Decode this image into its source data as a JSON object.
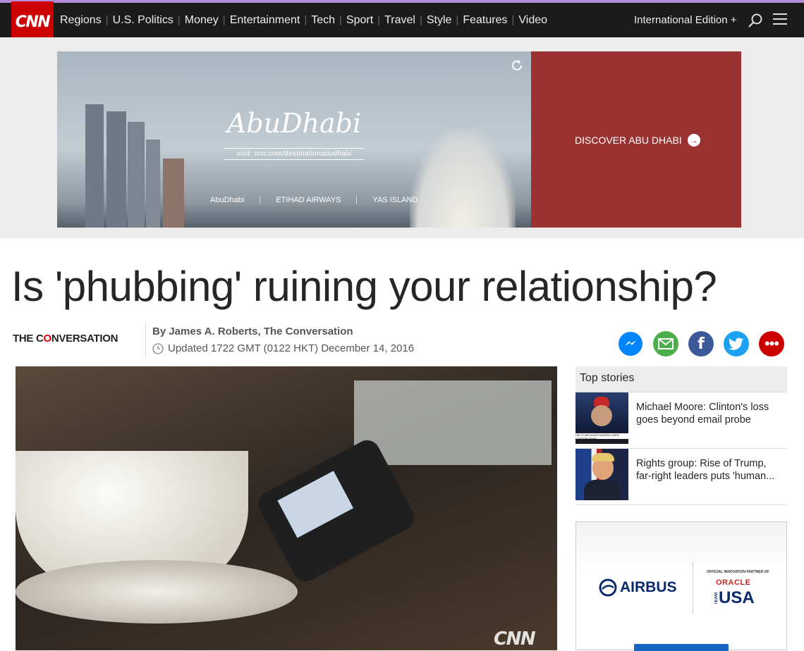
{
  "nav": {
    "logo": "CNN",
    "links": [
      "Regions",
      "U.S. Politics",
      "Money",
      "Entertainment",
      "Tech",
      "Sport",
      "Travel",
      "Style",
      "Features",
      "Video"
    ],
    "edition": "International Edition +"
  },
  "ad_banner": {
    "title": "AbuDhabi",
    "visit": "visit: cnn.com/destinationabudhabi",
    "logos": [
      "AbuDhabi",
      "ETIHAD AIRWAYS",
      "YAS ISLAND"
    ],
    "cta": "DISCOVER ABU DHABI",
    "cta_color": "#9b3232"
  },
  "article": {
    "headline": "Is 'phubbing' ruining your relationship?",
    "source_logo": {
      "pre": "THE C",
      "o": "O",
      "post": "NVERSATION"
    },
    "byline": "By James A. Roberts, The Conversation",
    "updated": "Updated 1722 GMT (0122 HKT) December 14, 2016",
    "image_watermark": "CNN"
  },
  "share_icons": [
    "messenger-icon",
    "email-icon",
    "facebook-icon",
    "twitter-icon",
    "more-icon"
  ],
  "top_stories": {
    "heading": "Top stories",
    "items": [
      {
        "title": "Michael Moore: Clinton's loss goes beyond email probe",
        "thumb_caption": "FBI TO BE INVESTIGATED OVER CLINTON EMAIL"
      },
      {
        "title": "Rights group: Rise of Trump, far-right leaders puts 'human..."
      }
    ]
  },
  "rail_ad": {
    "airbus": "AIRBUS",
    "oracle_top": "OFFICIAL INNOVATION PARTNER OF",
    "oracle": "ORACLE",
    "team": "USA",
    "team_vertical": "TEAM"
  },
  "colors": {
    "brand_red": "#cc0000",
    "nav_bg": "#1b1b1b"
  }
}
